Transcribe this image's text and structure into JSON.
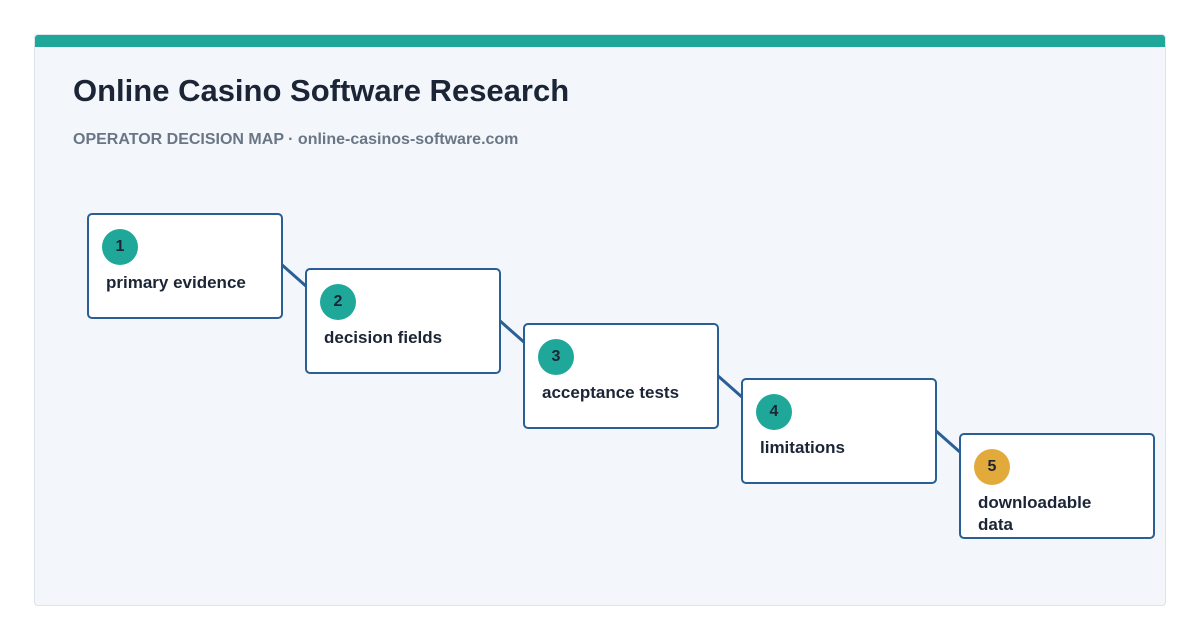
{
  "header": {
    "title": "Online Casino Software Research",
    "subtitle": "OPERATOR DECISION MAP · online-casinos-software.com"
  },
  "colors": {
    "accent": "#1fa89a",
    "badge_default": "#1fa89a",
    "badge_final": "#e2a93b",
    "border": "#2a5f95"
  },
  "steps": [
    {
      "number": "1",
      "label": "primary evidence"
    },
    {
      "number": "2",
      "label": "decision fields"
    },
    {
      "number": "3",
      "label": "acceptance tests"
    },
    {
      "number": "4",
      "label": "limitations"
    },
    {
      "number": "5",
      "label": "downloadable data"
    }
  ]
}
